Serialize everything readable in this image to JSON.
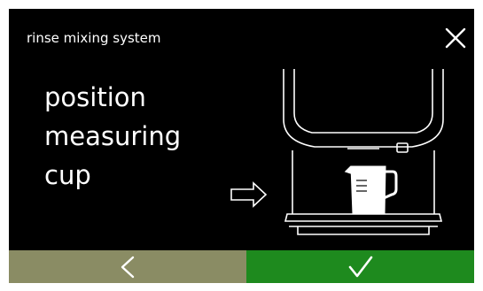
{
  "header": {
    "title": "rinse mixing system",
    "close_icon": "close-icon"
  },
  "instruction": {
    "lines": [
      "position",
      "measuring",
      "cup"
    ]
  },
  "illustration": {
    "arrow_icon": "arrow-right-icon",
    "machine": "coffee-machine-outline",
    "cup": "measuring-cup-icon"
  },
  "footer": {
    "back_icon": "chevron-left-icon",
    "confirm_icon": "checkmark-icon"
  },
  "colors": {
    "screen_bg": "#000000",
    "text": "#ffffff",
    "back_button": "#8a8c64",
    "confirm_button": "#1e8a1e",
    "frame": "#ffffff"
  }
}
